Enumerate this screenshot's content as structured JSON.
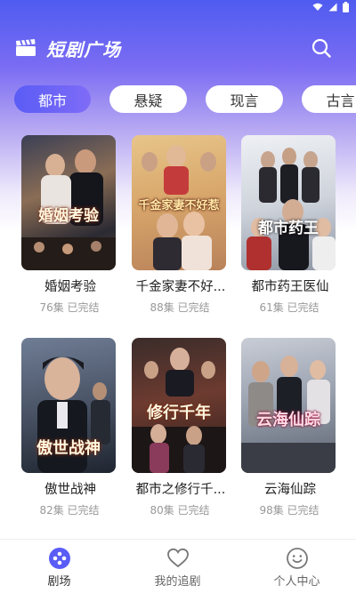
{
  "header": {
    "title": "短剧广场"
  },
  "tabs": [
    {
      "label": "都市",
      "active": true
    },
    {
      "label": "悬疑",
      "active": false
    },
    {
      "label": "现言",
      "active": false
    },
    {
      "label": "古言",
      "active": false
    }
  ],
  "dramas": [
    {
      "title": "婚姻考验",
      "episodes": "76集",
      "status": "已完结",
      "poster_text": "婚姻考验"
    },
    {
      "title": "千金家妻不好...",
      "episodes": "88集",
      "status": "已完结",
      "poster_text": "千金家妻不好惹"
    },
    {
      "title": "都市药王医仙",
      "episodes": "61集",
      "status": "已完结",
      "poster_text": "都市药王"
    },
    {
      "title": "傲世战神",
      "episodes": "82集",
      "status": "已完结",
      "poster_text": "傲世战神"
    },
    {
      "title": "都市之修行千...",
      "episodes": "80集",
      "status": "已完结",
      "poster_text": "修行千年"
    },
    {
      "title": "云海仙踪",
      "episodes": "98集",
      "status": "已完结",
      "poster_text": "云海仙踪"
    }
  ],
  "nav": [
    {
      "label": "剧场",
      "icon": "theater-icon",
      "active": true
    },
    {
      "label": "我的追剧",
      "icon": "heart-icon",
      "active": false
    },
    {
      "label": "个人中心",
      "icon": "smiley-icon",
      "active": false
    }
  ],
  "colors": {
    "accent": "#5a5cf6",
    "accent_end": "#7f6cf7"
  }
}
